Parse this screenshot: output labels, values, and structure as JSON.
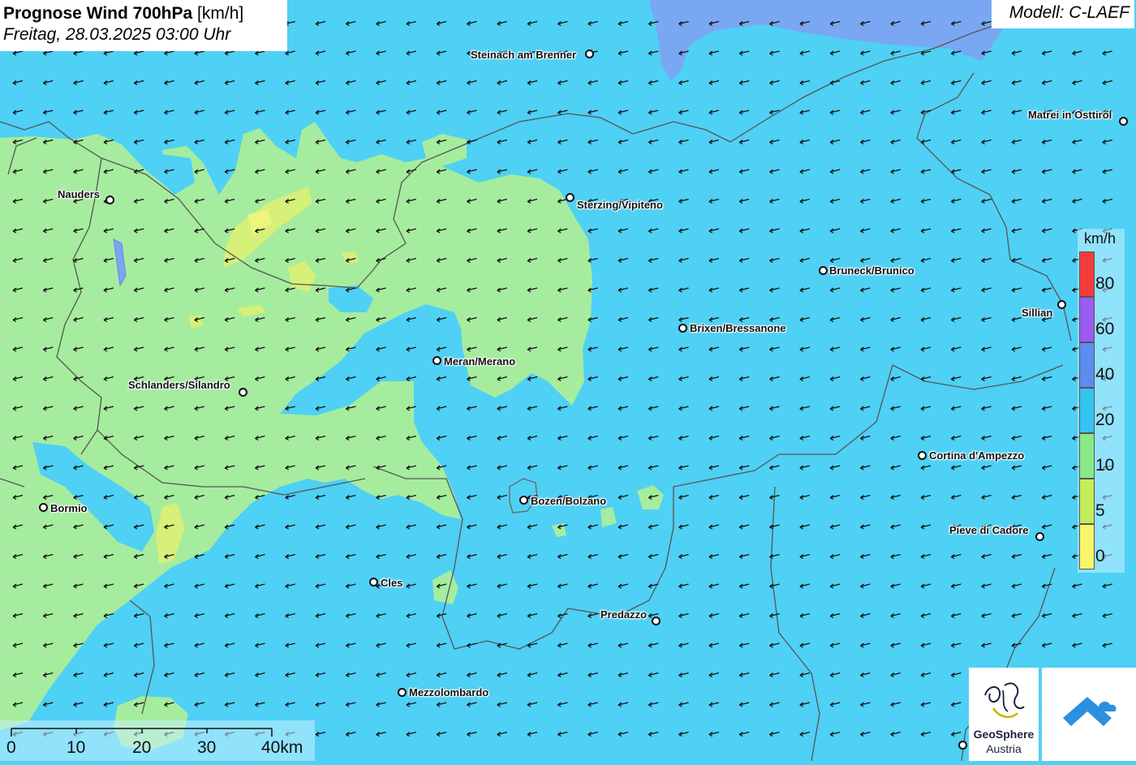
{
  "header": {
    "title_bold": "Prognose Wind 700hPa",
    "title_unit": "[km/h]",
    "subtitle": "Freitag, 28.03.2025 03:00 Uhr",
    "model": "Modell: C-LAEF"
  },
  "cities": [
    {
      "name": "Steinach am Brenner",
      "id": "steinach"
    },
    {
      "name": "Matrei in Osttirol",
      "id": "matrei"
    },
    {
      "name": "Nauders",
      "id": "nauders"
    },
    {
      "name": "Sterzing/Vipiteno",
      "id": "sterzing"
    },
    {
      "name": "Bruneck/Brunico",
      "id": "bruneck"
    },
    {
      "name": "Sillian",
      "id": "sillian"
    },
    {
      "name": "Brixen/Bressanone",
      "id": "brixen"
    },
    {
      "name": "Meran/Merano",
      "id": "meran"
    },
    {
      "name": "Schlanders/Silandro",
      "id": "schlanders"
    },
    {
      "name": "Cortina d'Ampezzo",
      "id": "cortina"
    },
    {
      "name": "Bormio",
      "id": "bormio"
    },
    {
      "name": "Bozen/Bolzano",
      "id": "bozen"
    },
    {
      "name": "Pieve di Cadore",
      "id": "pieve"
    },
    {
      "name": "Cles",
      "id": "cles"
    },
    {
      "name": "Predazzo",
      "id": "predazzo"
    },
    {
      "name": "Mezzolombardo",
      "id": "mezzolombardo"
    }
  ],
  "legend": {
    "unit": "km/h",
    "labels": [
      "80",
      "60",
      "40",
      "20",
      "10",
      "5",
      "0"
    ],
    "colors": [
      "#f23c3c",
      "#9a5cf0",
      "#5c8cf0",
      "#34c4f2",
      "#8ae885",
      "#c4ec5c",
      "#f7f56a"
    ]
  },
  "scalebar": {
    "labels": [
      "0",
      "10",
      "20",
      "30",
      "40km"
    ]
  },
  "logos": {
    "geosphere_line1": "GeoSphere",
    "geosphere_line2": "Austria"
  },
  "colors": {
    "wind_20_40": "#4fd0f5",
    "wind_40_60": "#7ca4f0",
    "wind_10_20": "#a6ec9e",
    "wind_5_10": "#d6f07a",
    "wind_0_5": "#eef57c"
  }
}
